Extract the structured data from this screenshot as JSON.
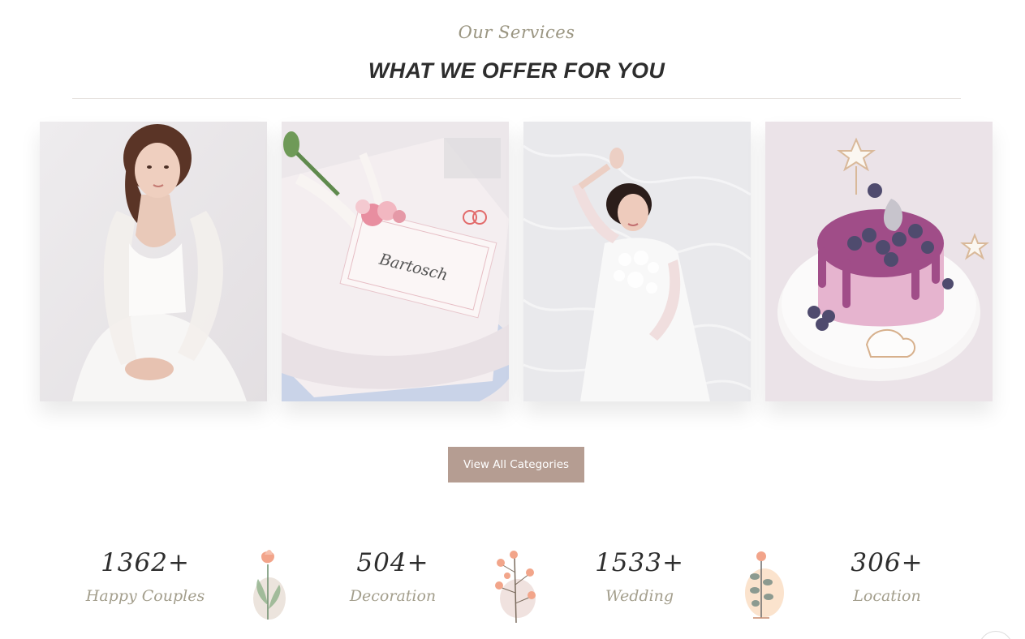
{
  "section": {
    "subtitle": "Our Services",
    "title": "WHAT WE OFFER FOR YOU"
  },
  "gallery": [
    {
      "subject": "bride in tulle gown"
    },
    {
      "subject": "place card with flowers",
      "card_text": "Bartosch"
    },
    {
      "subject": "bride lying on lace"
    },
    {
      "subject": "berry wedding cake"
    }
  ],
  "cta": {
    "label": "View All Categories"
  },
  "stats": [
    {
      "number": "1362+",
      "label": "Happy Couples"
    },
    {
      "number": "504+",
      "label": "Decoration"
    },
    {
      "number": "1533+",
      "label": "Wedding"
    },
    {
      "number": "306+",
      "label": "Location"
    }
  ],
  "colors": {
    "accent": "#b59d92",
    "script_text": "#9a9581",
    "heading": "#2d2d2d"
  }
}
